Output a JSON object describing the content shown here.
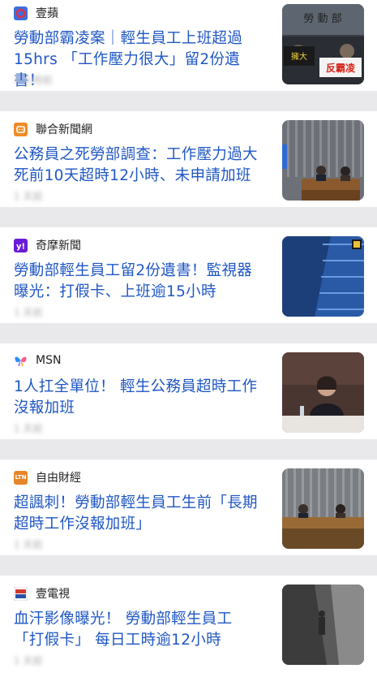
{
  "articles": [
    {
      "source": "壹蘋",
      "source_icon": "apple-daily-icon",
      "icon_color": "#3b6fe0",
      "headline": "勞動部霸凌案｜輕生員工上班超過15hrs 「工作壓力很大」留2份遺書！",
      "meta": "2 小時前",
      "thumb_sign_a": "擁大",
      "thumb_sign_b": "反霸凌"
    },
    {
      "source": "聯合新聞網",
      "source_icon": "udn-icon",
      "icon_color": "#f08b24",
      "headline": "公務員之死勞部調查：工作壓力過大 死前10天超時12小時、未申請加班",
      "meta": "1 天前"
    },
    {
      "source": "奇摩新聞",
      "source_icon": "yahoo-icon",
      "icon_color": "#6a1bd6",
      "headline": "勞動部輕生員工留2份遺書！監視器曝光：打假卡、上班逾15小時",
      "meta": "1 天前"
    },
    {
      "source": "MSN",
      "source_icon": "msn-butterfly-icon",
      "icon_color": "#2f8cff",
      "headline": "1人扛全單位！ 輕生公務員超時工作沒報加班",
      "meta": "1 天前"
    },
    {
      "source": "自由財經",
      "source_icon": "ltn-icon",
      "icon_color": "#e6862a",
      "icon_text": "LTN",
      "headline": "超諷刺！勞動部輕生員工生前「長期超時工作沒報加班」",
      "meta": "1 天前"
    },
    {
      "source": "壹電視",
      "source_icon": "nexttv-icon",
      "icon_color": "#d33a2c",
      "headline": "血汗影像曝光！ 勞動部輕生員工「打假卡」 每日工時逾12小時",
      "meta": "1 天前"
    }
  ]
}
